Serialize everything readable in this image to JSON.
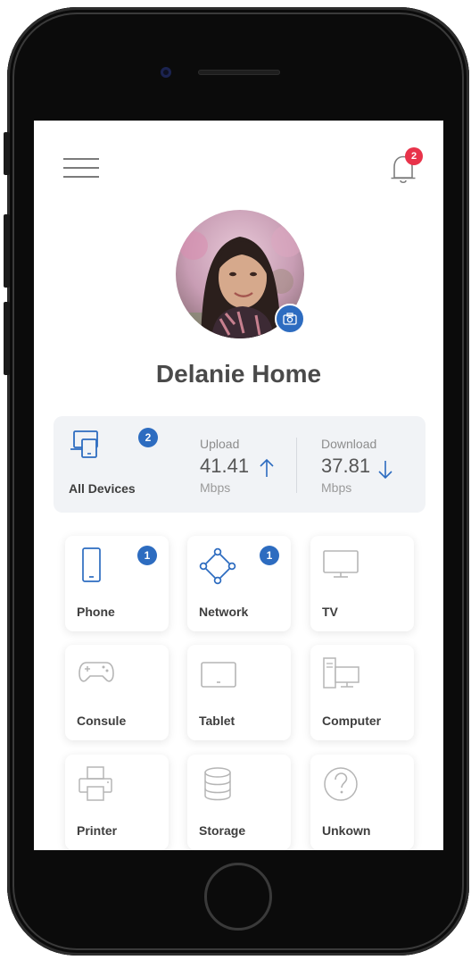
{
  "header": {
    "notification_count": "2"
  },
  "profile": {
    "home_name": "Delanie Home"
  },
  "stats": {
    "all_devices_label": "All Devices",
    "all_devices_count": "2",
    "upload": {
      "title": "Upload",
      "value": "41.41",
      "unit": "Mbps"
    },
    "download": {
      "title": "Download",
      "value": "37.81",
      "unit": "Mbps"
    }
  },
  "tiles": [
    {
      "label": "Phone",
      "icon": "phone-icon",
      "badge": "1"
    },
    {
      "label": "Network",
      "icon": "network-icon",
      "badge": "1"
    },
    {
      "label": "TV",
      "icon": "tv-icon"
    },
    {
      "label": "Consule",
      "icon": "gamepad-icon"
    },
    {
      "label": "Tablet",
      "icon": "tablet-icon"
    },
    {
      "label": "Computer",
      "icon": "computer-icon"
    },
    {
      "label": "Printer",
      "icon": "printer-icon"
    },
    {
      "label": "Storage",
      "icon": "database-icon"
    },
    {
      "label": "Unkown",
      "icon": "question-icon"
    }
  ],
  "colors": {
    "accent": "#2d6cc0",
    "alert": "#e8334a",
    "panel": "#f1f3f6"
  }
}
